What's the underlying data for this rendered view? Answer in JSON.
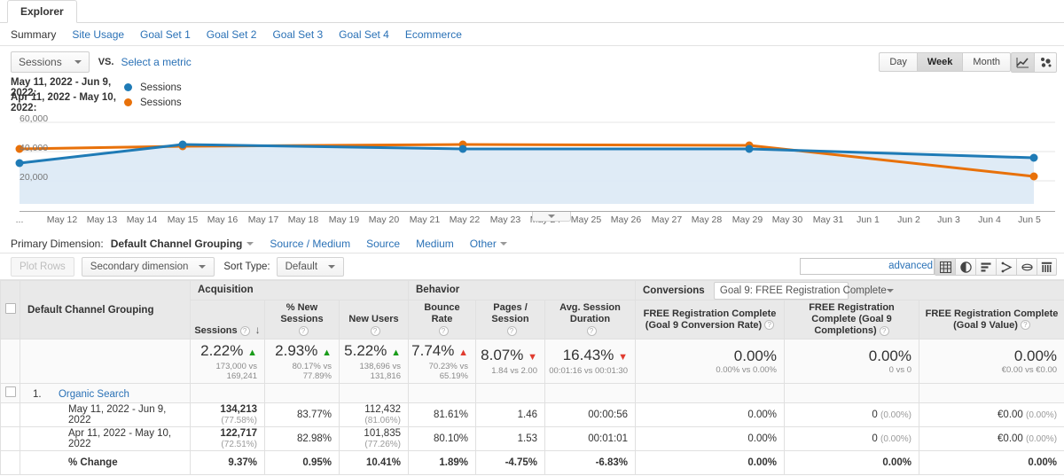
{
  "tab": {
    "label": "Explorer"
  },
  "subtabs": [
    {
      "label": "Summary",
      "active": true
    },
    {
      "label": "Site Usage",
      "active": false
    },
    {
      "label": "Goal Set 1",
      "active": false
    },
    {
      "label": "Goal Set 2",
      "active": false
    },
    {
      "label": "Goal Set 3",
      "active": false
    },
    {
      "label": "Goal Set 4",
      "active": false
    },
    {
      "label": "Ecommerce",
      "active": false
    }
  ],
  "metricbar": {
    "metric": "Sessions",
    "vs": "VS.",
    "select_metric": "Select a metric",
    "ranges": [
      {
        "label": "Day",
        "active": false
      },
      {
        "label": "Week",
        "active": true
      },
      {
        "label": "Month",
        "active": false
      }
    ],
    "chart_types": [
      {
        "name": "line-chart-icon",
        "active": true
      },
      {
        "name": "motion-chart-icon",
        "active": false
      }
    ]
  },
  "legend": [
    {
      "range": "May 11, 2022 - Jun 9, 2022:",
      "metric": "Sessions",
      "color": "#1f7bb6"
    },
    {
      "range": "Apr 11, 2022 - May 10, 2022:",
      "metric": "Sessions",
      "color": "#e8710a"
    }
  ],
  "chart_data": {
    "type": "line",
    "title": "Sessions",
    "xlabel": "",
    "ylabel": "",
    "ylim": [
      0,
      70000
    ],
    "yticks": [
      20000,
      40000,
      60000
    ],
    "ytick_labels": [
      "20,000",
      "40,000",
      "60,000"
    ],
    "grid": true,
    "legend_position": "top-left",
    "x": [
      "...",
      "May 12",
      "May 13",
      "May 14",
      "May 15",
      "May 16",
      "May 17",
      "May 18",
      "May 19",
      "May 20",
      "May 21",
      "May 22",
      "May 23",
      "May 24",
      "May 25",
      "May 26",
      "May 27",
      "May 28",
      "May 29",
      "May 30",
      "May 31",
      "Jun 1",
      "Jun 2",
      "Jun 3",
      "Jun 4",
      "Jun 5"
    ],
    "series": [
      {
        "name": "May 11, 2022 - Jun 9, 2022: Sessions",
        "color": "#1f7bb6",
        "markers_at": [
          "May 11",
          "May 15",
          "May 22",
          "May 29",
          "Jun 5"
        ],
        "marker_values": [
          27500,
          43000,
          40500,
          40500,
          35500
        ]
      },
      {
        "name": "Apr 11, 2022 - May 10, 2022: Sessions",
        "color": "#e8710a",
        "markers_at": [
          "Apr 11",
          "Apr 15",
          "Apr 22",
          "Apr 29",
          "May 6"
        ],
        "marker_values": [
          37500,
          41500,
          43000,
          42500,
          23500
        ]
      }
    ]
  },
  "primary_dimension": {
    "label": "Primary Dimension:",
    "selected": "Default Channel Grouping",
    "options": [
      "Source / Medium",
      "Source",
      "Medium",
      "Other"
    ]
  },
  "controls": {
    "plot_rows": "Plot Rows",
    "secondary_dimension": "Secondary dimension",
    "sort_type_label": "Sort Type:",
    "sort_type_value": "Default",
    "search_value": "",
    "search_placeholder": "",
    "advanced": "advanced",
    "view_icons": [
      {
        "name": "table-view-icon",
        "active": true
      },
      {
        "name": "pie-chart-view-icon",
        "active": false
      },
      {
        "name": "performance-view-icon",
        "active": false
      },
      {
        "name": "comparison-view-icon",
        "active": false
      },
      {
        "name": "term-cloud-view-icon",
        "active": false
      },
      {
        "name": "pivot-view-icon",
        "active": false
      }
    ]
  },
  "table": {
    "dimension_header": "Default Channel Grouping",
    "groups": [
      {
        "label": "Acquisition"
      },
      {
        "label": "Behavior"
      },
      {
        "label": "Conversions",
        "selector": "Goal 9: FREE Registration Complete"
      }
    ],
    "columns": [
      {
        "label": "Sessions",
        "help": true,
        "sorted": true
      },
      {
        "label": "% New Sessions",
        "help": true
      },
      {
        "label": "New Users",
        "help": true
      },
      {
        "label": "Bounce Rate",
        "help": true
      },
      {
        "label": "Pages / Session",
        "help": true
      },
      {
        "label": "Avg. Session Duration",
        "help": true
      },
      {
        "label": "FREE Registration Complete (Goal 9 Conversion Rate)",
        "help": true
      },
      {
        "label": "FREE Registration Complete (Goal 9 Completions)",
        "help": true
      },
      {
        "label": "FREE Registration Complete (Goal 9 Value)",
        "help": true
      }
    ],
    "summary": [
      {
        "value": "2.22%",
        "dir": "up",
        "sub": "173,000 vs 169,241"
      },
      {
        "value": "2.93%",
        "dir": "up",
        "sub": "80.17% vs 77.89%"
      },
      {
        "value": "5.22%",
        "dir": "up",
        "sub": "138,696 vs 131,816"
      },
      {
        "value": "7.74%",
        "dir": "up",
        "sub": "70.23% vs 65.19%"
      },
      {
        "value": "8.07%",
        "dir": "down",
        "sub": "1.84 vs 2.00"
      },
      {
        "value": "16.43%",
        "dir": "down",
        "sub": "00:01:16 vs 00:01:30"
      },
      {
        "value": "0.00%",
        "dir": "none",
        "sub": "0.00% vs 0.00%"
      },
      {
        "value": "0.00%",
        "dir": "none",
        "sub": "0 vs 0"
      },
      {
        "value": "0.00%",
        "dir": "none",
        "sub": "€0.00 vs €0.00"
      }
    ],
    "rows": [
      {
        "index": "1.",
        "name": "Organic Search",
        "periods": [
          {
            "label": "May 11, 2022 - Jun 9, 2022",
            "cells": [
              {
                "main": "134,213",
                "pct": "(77.58%)",
                "bold": true
              },
              {
                "main": "83.77%",
                "pct": ""
              },
              {
                "main": "112,432",
                "pct": "(81.06%)"
              },
              {
                "main": "81.61%",
                "pct": ""
              },
              {
                "main": "1.46",
                "pct": ""
              },
              {
                "main": "00:00:56",
                "pct": ""
              },
              {
                "main": "0.00%",
                "pct": ""
              },
              {
                "main": "0",
                "pct": "(0.00%)"
              },
              {
                "main": "€0.00",
                "pct": "(0.00%)"
              }
            ]
          },
          {
            "label": "Apr 11, 2022 - May 10, 2022",
            "cells": [
              {
                "main": "122,717",
                "pct": "(72.51%)",
                "bold": true
              },
              {
                "main": "82.98%",
                "pct": ""
              },
              {
                "main": "101,835",
                "pct": "(77.26%)"
              },
              {
                "main": "80.10%",
                "pct": ""
              },
              {
                "main": "1.53",
                "pct": ""
              },
              {
                "main": "00:01:01",
                "pct": ""
              },
              {
                "main": "0.00%",
                "pct": ""
              },
              {
                "main": "0",
                "pct": "(0.00%)"
              },
              {
                "main": "€0.00",
                "pct": "(0.00%)"
              }
            ]
          }
        ],
        "change": {
          "label": "% Change",
          "cells": [
            "9.37%",
            "0.95%",
            "10.41%",
            "1.89%",
            "-4.75%",
            "-6.83%",
            "0.00%",
            "0.00%",
            "0.00%"
          ]
        }
      }
    ]
  },
  "colors": {
    "series_current": "#1f7bb6",
    "series_previous": "#e8710a",
    "link": "#2a71b6",
    "up": "#1a9c1a",
    "down": "#e03b2f",
    "chart_fill": "#ddeaf5"
  }
}
